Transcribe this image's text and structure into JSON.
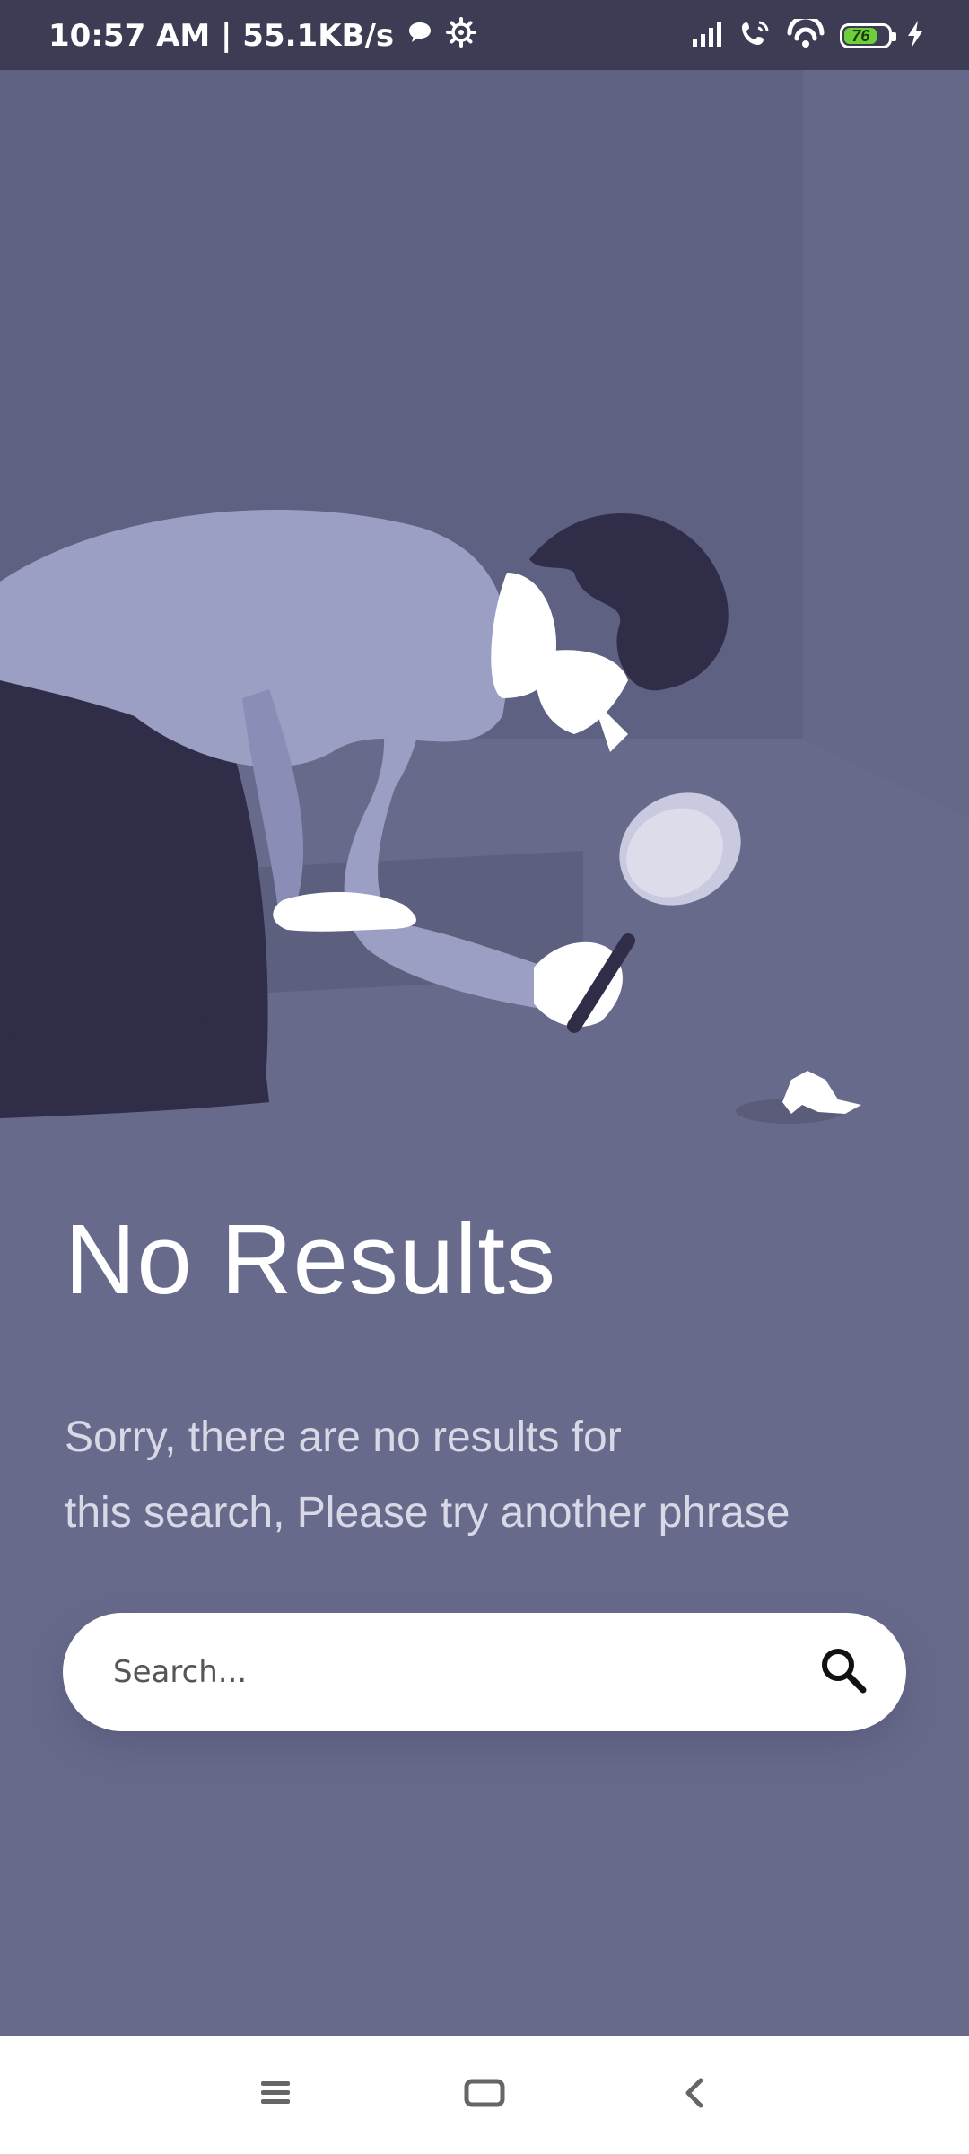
{
  "status_bar": {
    "time_speed": "10:57 AM | 55.1KB/s",
    "battery_level": "76",
    "icons": [
      "chat-bubble-icon",
      "settings-gear-icon",
      "signal-icon",
      "wifi-call-icon",
      "hotspot-icon",
      "battery-icon",
      "charging-icon"
    ]
  },
  "empty_state": {
    "title": "No Results",
    "message_line1": "Sorry, there are no results for",
    "message_line2": "this search, Please try another phrase"
  },
  "search": {
    "placeholder": "Search...",
    "icon": "search-icon"
  },
  "nav_bar": {
    "buttons": [
      "menu-icon",
      "home-icon",
      "back-icon"
    ]
  },
  "colors": {
    "background": "#686a8b",
    "status_bar": "#3c3c55",
    "accent_dark": "#2f2c47",
    "sweater": "#9c9fc4"
  }
}
